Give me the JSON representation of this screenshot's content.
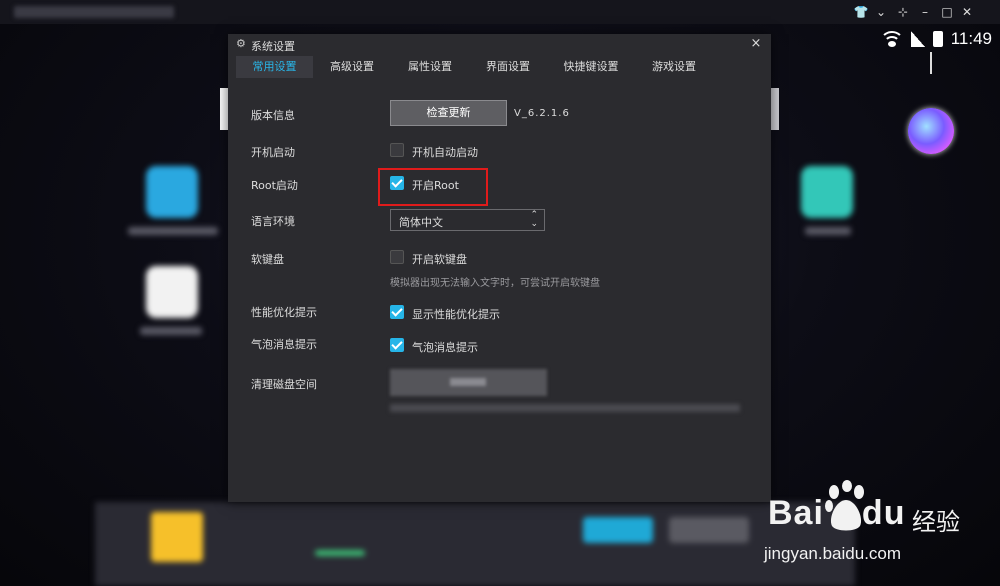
{
  "statusbar": {
    "time": "11:49"
  },
  "dialog": {
    "title": "系统设置",
    "close": "×",
    "tabs": [
      {
        "label": "常用设置",
        "active": true
      },
      {
        "label": "高级设置"
      },
      {
        "label": "属性设置"
      },
      {
        "label": "界面设置"
      },
      {
        "label": "快捷键设置"
      },
      {
        "label": "游戏设置"
      }
    ],
    "version_info": {
      "label": "版本信息",
      "button": "检查更新",
      "version": "V_6.2.1.6"
    },
    "boot_start": {
      "label": "开机启动",
      "option": "开机自动启动",
      "checked": false
    },
    "root_start": {
      "label": "Root启动",
      "option": "开启Root",
      "checked": true
    },
    "language": {
      "label": "语言环境",
      "selected": "简体中文"
    },
    "soft_keyboard": {
      "label": "软键盘",
      "option": "开启软键盘",
      "checked": false,
      "hint": "模拟器出现无法输入文字时，可尝试开启软键盘"
    },
    "perf_tip": {
      "label": "性能优化提示",
      "option": "显示性能优化提示",
      "checked": true
    },
    "bubble_tip": {
      "label": "气泡消息提示",
      "option": "气泡消息提示",
      "checked": true
    },
    "disk_clean": {
      "label": "清理磁盘空间"
    }
  },
  "watermark": {
    "brand": "Bai",
    "brand_end": "du",
    "product": "经验",
    "url": "jingyan.baidu.com"
  },
  "colors": {
    "accent": "#26b5e8",
    "highlight_box": "#e01b1b",
    "dialog_bg": "#2b2b2f"
  }
}
